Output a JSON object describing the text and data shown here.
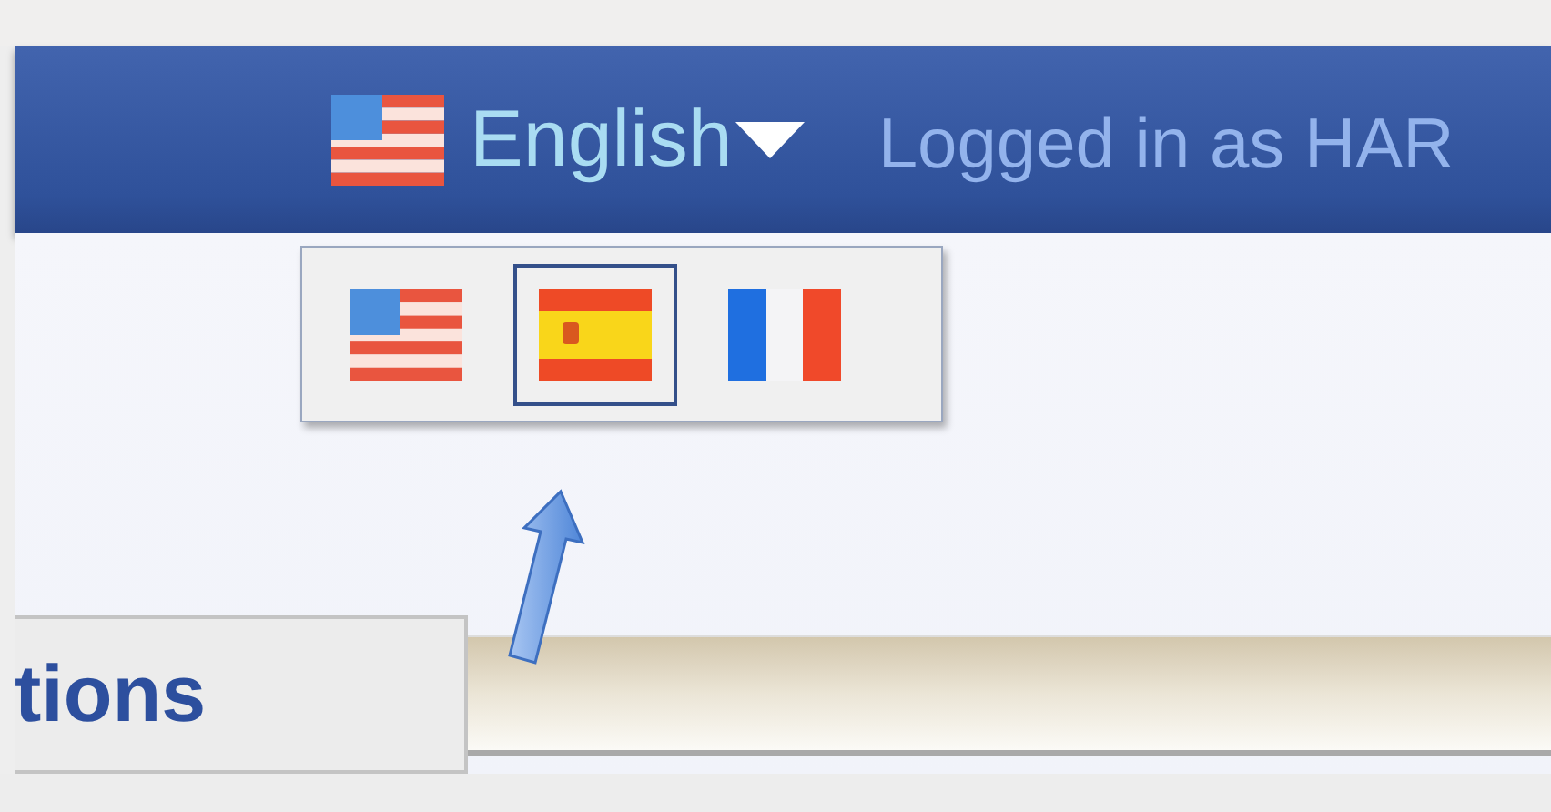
{
  "header": {
    "language": {
      "label": "English"
    },
    "user_text": "Logged in as HAR"
  },
  "language_menu": {
    "items": [
      {
        "selected": false
      },
      {
        "selected": true
      },
      {
        "selected": false
      }
    ]
  },
  "tabs": [
    {
      "label": "tions"
    }
  ]
}
